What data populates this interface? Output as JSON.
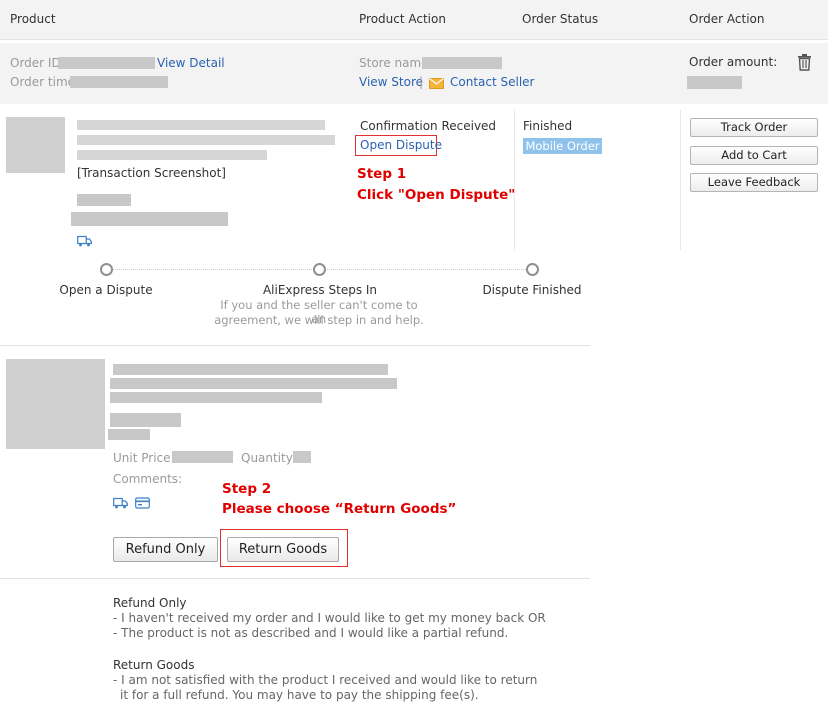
{
  "header": {
    "product": "Product",
    "product_action": "Product Action",
    "order_status": "Order Status",
    "order_action": "Order Action"
  },
  "order_info": {
    "order_id_label": "Order ID:",
    "view_detail": "View Detail",
    "order_time_label": "Order time:",
    "store_name_label": "Store name:",
    "view_store": "View Store",
    "separator": "|",
    "contact_seller": "Contact Seller",
    "order_amount_label": "Order amount:",
    "icons": [
      "trash-icon",
      "envelope-icon"
    ]
  },
  "order_row": {
    "transaction_screenshot": "[Transaction Screenshot]",
    "action_status": "Confirmation Received",
    "open_dispute": "Open Dispute",
    "order_status": "Finished",
    "mobile_badge": "Mobile Order",
    "buttons": [
      "Track Order",
      "Add to Cart",
      "Leave Feedback"
    ],
    "icons": [
      "truck-icon"
    ]
  },
  "steps": {
    "step1_title": "Step 1",
    "step1_text": "Click \"Open Dispute\"",
    "step2_title": "Step 2",
    "step2_text": "Please choose “Return Goods”"
  },
  "progress": {
    "stages": [
      "Open a Dispute",
      "AliExpress Steps In",
      "Dispute Finished"
    ],
    "description_line1": "If you and the seller can't come to an",
    "description_line2": "agreement, we will step in and help."
  },
  "dispute_form": {
    "unit_price_label": "Unit Price:",
    "quantity_label": "Quantity:",
    "comments_label": "Comments:",
    "refund_only_button": "Refund Only",
    "return_goods_button": "Return Goods",
    "icons": [
      "truck-icon",
      "card-icon"
    ]
  },
  "explanations": {
    "refund_only_title": "Refund Only",
    "refund_only_line1": "- I haven't received my order and I would like to get my money back OR",
    "refund_only_line2": "- The product is not as described and I would like a partial refund.",
    "return_goods_title": "Return Goods",
    "return_goods_line1": "- I am not satisfied with the product I received and would like to return",
    "return_goods_line2": "it for a full refund. You may have to pay the shipping fee(s)."
  },
  "colors": {
    "link": "#2a62b3",
    "annotation_red": "#e00000",
    "mobile_badge_bg": "#8fc3ec",
    "header_bg": "#f3f3f3"
  }
}
